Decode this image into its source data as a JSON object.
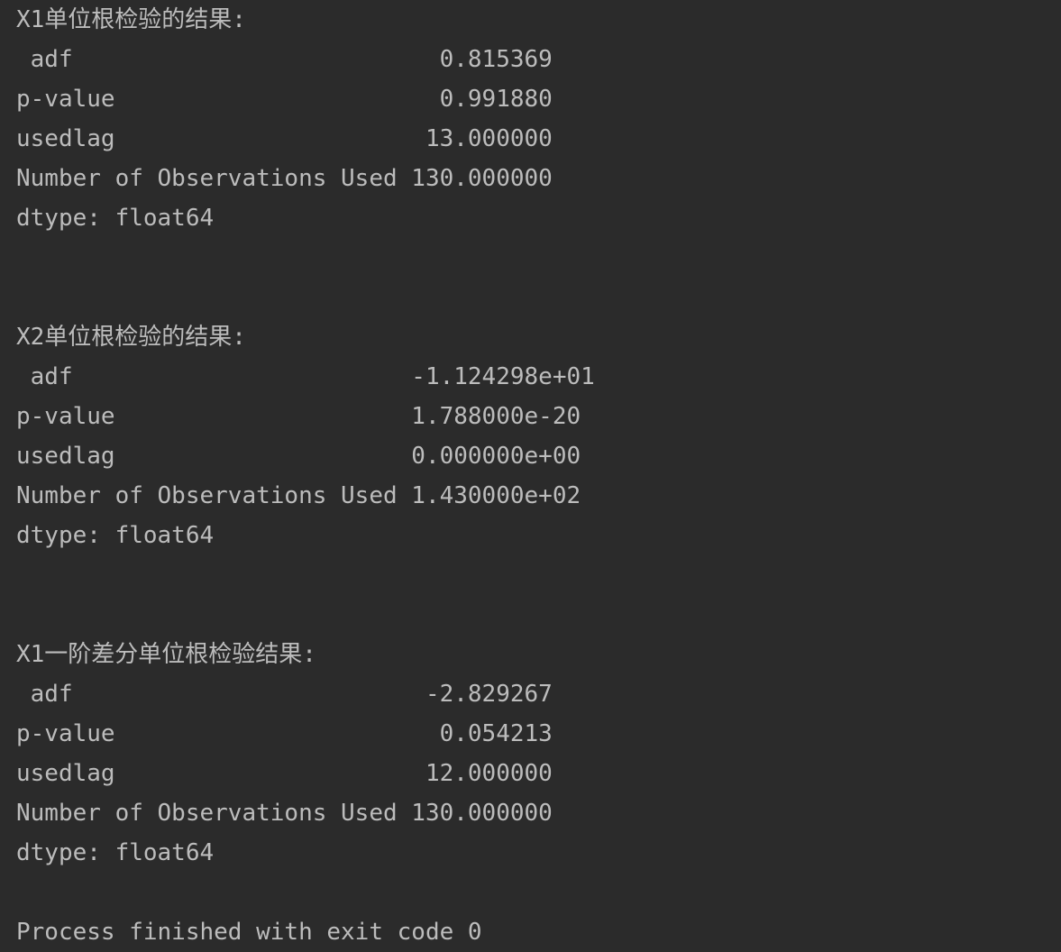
{
  "console": {
    "background_color": "#2b2b2b",
    "text_color": "#bcbcbc",
    "blocks": [
      {
        "header": "X1单位根检验的结果:",
        "rows": [
          {
            "label": " adf",
            "value": "0.815369"
          },
          {
            "label": "p-value",
            "value": "0.991880"
          },
          {
            "label": "usedlag",
            "value": "13.000000"
          },
          {
            "label": "Number of Observations Used",
            "value": "130.000000"
          }
        ],
        "dtype": "dtype: float64",
        "lines": [
          "X1单位根检验的结果:",
          " adf                          0.815369",
          "p-value                       0.991880",
          "usedlag                      13.000000",
          "Number of Observations Used 130.000000",
          "dtype: float64"
        ]
      },
      {
        "header": "X2单位根检验的结果:",
        "rows": [
          {
            "label": " adf",
            "value": "-1.124298e+01"
          },
          {
            "label": "p-value",
            "value": "1.788000e-20"
          },
          {
            "label": "usedlag",
            "value": "0.000000e+00"
          },
          {
            "label": "Number of Observations Used",
            "value": "1.430000e+02"
          }
        ],
        "dtype": "dtype: float64",
        "lines": [
          "X2单位根检验的结果:",
          " adf                        -1.124298e+01",
          "p-value                     1.788000e-20",
          "usedlag                     0.000000e+00",
          "Number of Observations Used 1.430000e+02",
          "dtype: float64"
        ]
      },
      {
        "header": "X1一阶差分单位根检验结果:",
        "rows": [
          {
            "label": " adf",
            "value": "-2.829267"
          },
          {
            "label": "p-value",
            "value": "0.054213"
          },
          {
            "label": "usedlag",
            "value": "12.000000"
          },
          {
            "label": "Number of Observations Used",
            "value": "130.000000"
          }
        ],
        "dtype": "dtype: float64",
        "lines": [
          "X1一阶差分单位根检验结果:",
          " adf                         -2.829267",
          "p-value                       0.054213",
          "usedlag                      12.000000",
          "Number of Observations Used 130.000000",
          "dtype: float64"
        ]
      }
    ],
    "process_message": "Process finished with exit code 0"
  }
}
